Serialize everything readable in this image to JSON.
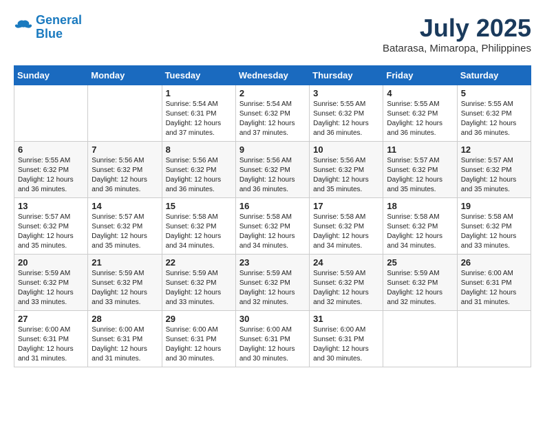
{
  "header": {
    "logo_line1": "General",
    "logo_line2": "Blue",
    "month_year": "July 2025",
    "location": "Batarasa, Mimaropa, Philippines"
  },
  "weekdays": [
    "Sunday",
    "Monday",
    "Tuesday",
    "Wednesday",
    "Thursday",
    "Friday",
    "Saturday"
  ],
  "weeks": [
    [
      {
        "day": "",
        "info": ""
      },
      {
        "day": "",
        "info": ""
      },
      {
        "day": "1",
        "info": "Sunrise: 5:54 AM\nSunset: 6:31 PM\nDaylight: 12 hours\nand 37 minutes."
      },
      {
        "day": "2",
        "info": "Sunrise: 5:54 AM\nSunset: 6:32 PM\nDaylight: 12 hours\nand 37 minutes."
      },
      {
        "day": "3",
        "info": "Sunrise: 5:55 AM\nSunset: 6:32 PM\nDaylight: 12 hours\nand 36 minutes."
      },
      {
        "day": "4",
        "info": "Sunrise: 5:55 AM\nSunset: 6:32 PM\nDaylight: 12 hours\nand 36 minutes."
      },
      {
        "day": "5",
        "info": "Sunrise: 5:55 AM\nSunset: 6:32 PM\nDaylight: 12 hours\nand 36 minutes."
      }
    ],
    [
      {
        "day": "6",
        "info": "Sunrise: 5:55 AM\nSunset: 6:32 PM\nDaylight: 12 hours\nand 36 minutes."
      },
      {
        "day": "7",
        "info": "Sunrise: 5:56 AM\nSunset: 6:32 PM\nDaylight: 12 hours\nand 36 minutes."
      },
      {
        "day": "8",
        "info": "Sunrise: 5:56 AM\nSunset: 6:32 PM\nDaylight: 12 hours\nand 36 minutes."
      },
      {
        "day": "9",
        "info": "Sunrise: 5:56 AM\nSunset: 6:32 PM\nDaylight: 12 hours\nand 36 minutes."
      },
      {
        "day": "10",
        "info": "Sunrise: 5:56 AM\nSunset: 6:32 PM\nDaylight: 12 hours\nand 35 minutes."
      },
      {
        "day": "11",
        "info": "Sunrise: 5:57 AM\nSunset: 6:32 PM\nDaylight: 12 hours\nand 35 minutes."
      },
      {
        "day": "12",
        "info": "Sunrise: 5:57 AM\nSunset: 6:32 PM\nDaylight: 12 hours\nand 35 minutes."
      }
    ],
    [
      {
        "day": "13",
        "info": "Sunrise: 5:57 AM\nSunset: 6:32 PM\nDaylight: 12 hours\nand 35 minutes."
      },
      {
        "day": "14",
        "info": "Sunrise: 5:57 AM\nSunset: 6:32 PM\nDaylight: 12 hours\nand 35 minutes."
      },
      {
        "day": "15",
        "info": "Sunrise: 5:58 AM\nSunset: 6:32 PM\nDaylight: 12 hours\nand 34 minutes."
      },
      {
        "day": "16",
        "info": "Sunrise: 5:58 AM\nSunset: 6:32 PM\nDaylight: 12 hours\nand 34 minutes."
      },
      {
        "day": "17",
        "info": "Sunrise: 5:58 AM\nSunset: 6:32 PM\nDaylight: 12 hours\nand 34 minutes."
      },
      {
        "day": "18",
        "info": "Sunrise: 5:58 AM\nSunset: 6:32 PM\nDaylight: 12 hours\nand 34 minutes."
      },
      {
        "day": "19",
        "info": "Sunrise: 5:58 AM\nSunset: 6:32 PM\nDaylight: 12 hours\nand 33 minutes."
      }
    ],
    [
      {
        "day": "20",
        "info": "Sunrise: 5:59 AM\nSunset: 6:32 PM\nDaylight: 12 hours\nand 33 minutes."
      },
      {
        "day": "21",
        "info": "Sunrise: 5:59 AM\nSunset: 6:32 PM\nDaylight: 12 hours\nand 33 minutes."
      },
      {
        "day": "22",
        "info": "Sunrise: 5:59 AM\nSunset: 6:32 PM\nDaylight: 12 hours\nand 33 minutes."
      },
      {
        "day": "23",
        "info": "Sunrise: 5:59 AM\nSunset: 6:32 PM\nDaylight: 12 hours\nand 32 minutes."
      },
      {
        "day": "24",
        "info": "Sunrise: 5:59 AM\nSunset: 6:32 PM\nDaylight: 12 hours\nand 32 minutes."
      },
      {
        "day": "25",
        "info": "Sunrise: 5:59 AM\nSunset: 6:32 PM\nDaylight: 12 hours\nand 32 minutes."
      },
      {
        "day": "26",
        "info": "Sunrise: 6:00 AM\nSunset: 6:31 PM\nDaylight: 12 hours\nand 31 minutes."
      }
    ],
    [
      {
        "day": "27",
        "info": "Sunrise: 6:00 AM\nSunset: 6:31 PM\nDaylight: 12 hours\nand 31 minutes."
      },
      {
        "day": "28",
        "info": "Sunrise: 6:00 AM\nSunset: 6:31 PM\nDaylight: 12 hours\nand 31 minutes."
      },
      {
        "day": "29",
        "info": "Sunrise: 6:00 AM\nSunset: 6:31 PM\nDaylight: 12 hours\nand 30 minutes."
      },
      {
        "day": "30",
        "info": "Sunrise: 6:00 AM\nSunset: 6:31 PM\nDaylight: 12 hours\nand 30 minutes."
      },
      {
        "day": "31",
        "info": "Sunrise: 6:00 AM\nSunset: 6:31 PM\nDaylight: 12 hours\nand 30 minutes."
      },
      {
        "day": "",
        "info": ""
      },
      {
        "day": "",
        "info": ""
      }
    ]
  ]
}
